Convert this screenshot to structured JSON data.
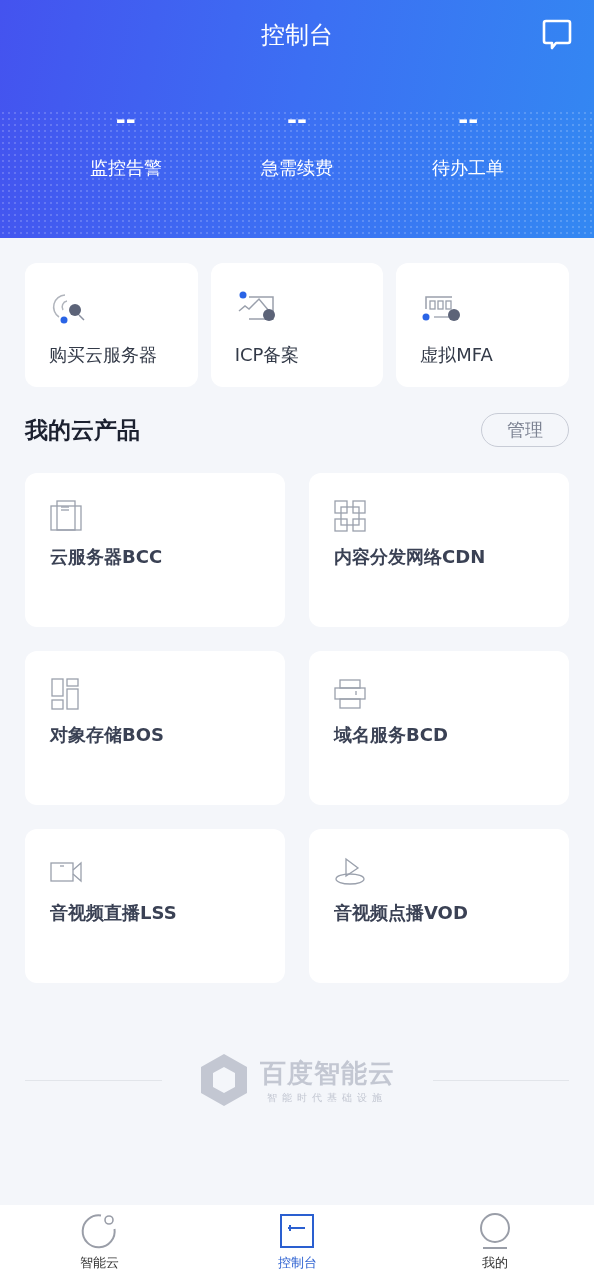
{
  "header": {
    "title": "控制台"
  },
  "stats": [
    {
      "value": "--",
      "label": "监控告警"
    },
    {
      "value": "--",
      "label": "急需续费"
    },
    {
      "value": "--",
      "label": "待办工单"
    }
  ],
  "quick_actions": [
    {
      "kind": "radar",
      "label": "购买云服务器"
    },
    {
      "kind": "chart",
      "label": "ICP备案"
    },
    {
      "kind": "mfa",
      "label": "虚拟MFA"
    }
  ],
  "products_section": {
    "title": "我的云产品",
    "manage_button": "管理"
  },
  "products": [
    {
      "kind": "server",
      "label": "云服务器BCC"
    },
    {
      "kind": "grid",
      "label": "内容分发网络CDN"
    },
    {
      "kind": "storage",
      "label": "对象存储BOS"
    },
    {
      "kind": "domain",
      "label": "域名服务BCD"
    },
    {
      "kind": "camera",
      "label": "音视频直播LSS"
    },
    {
      "kind": "play",
      "label": "音视频点播VOD"
    }
  ],
  "footer_logo": {
    "name": "百度智能云",
    "tagline": "智能时代基础设施"
  },
  "tabs": [
    {
      "kind": "cloud",
      "label": "智能云",
      "selected": false
    },
    {
      "kind": "console",
      "label": "控制台",
      "selected": true
    },
    {
      "kind": "user",
      "label": "我的",
      "selected": false
    }
  ]
}
